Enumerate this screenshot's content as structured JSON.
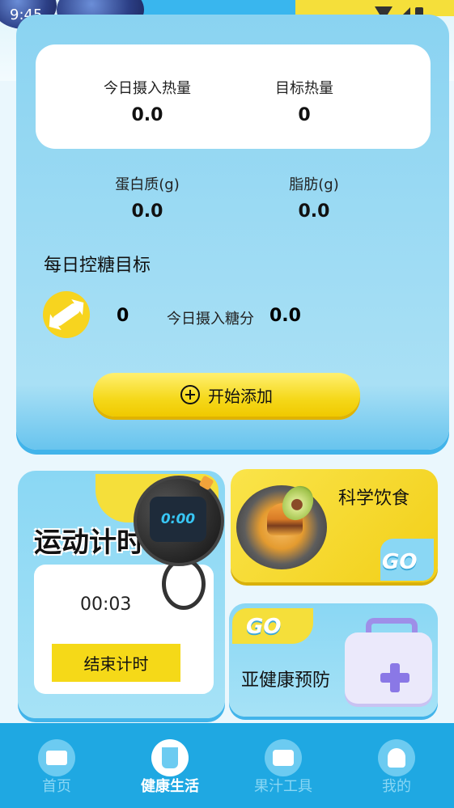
{
  "status_bar": {
    "time": "9:45"
  },
  "summary": {
    "today_intake_label": "今日摄入热量",
    "today_intake_value": "0.0",
    "target_label": "目标热量",
    "target_value": "0",
    "protein_label": "蛋白质(g)",
    "protein_value": "0.0",
    "fat_label": "脂肪(g)",
    "fat_value": "0.0"
  },
  "sugar": {
    "title": "每日控糖目标",
    "target_value": "0",
    "today_label": "今日摄入糖分",
    "today_value": "0.0"
  },
  "add_button": {
    "label": "开始添加"
  },
  "timer_card": {
    "title": "运动计时",
    "watch_display": "0:00",
    "elapsed": "00:03",
    "stop_label": "结束计时"
  },
  "diet_card": {
    "title": "科学饮食",
    "go_label": "GO"
  },
  "health_card": {
    "title": "亚健康预防",
    "go_label": "GO"
  },
  "nav": {
    "items": [
      {
        "label": "首页",
        "icon": "home-icon",
        "active": false
      },
      {
        "label": "健康生活",
        "icon": "cup-icon",
        "active": true
      },
      {
        "label": "果汁工具",
        "icon": "toolbox-icon",
        "active": false
      },
      {
        "label": "我的",
        "icon": "user-icon",
        "active": false
      }
    ]
  },
  "colors": {
    "primary_blue": "#1fa8e2",
    "card_blue": "#8ad3f1",
    "accent_yellow": "#f5d918"
  }
}
